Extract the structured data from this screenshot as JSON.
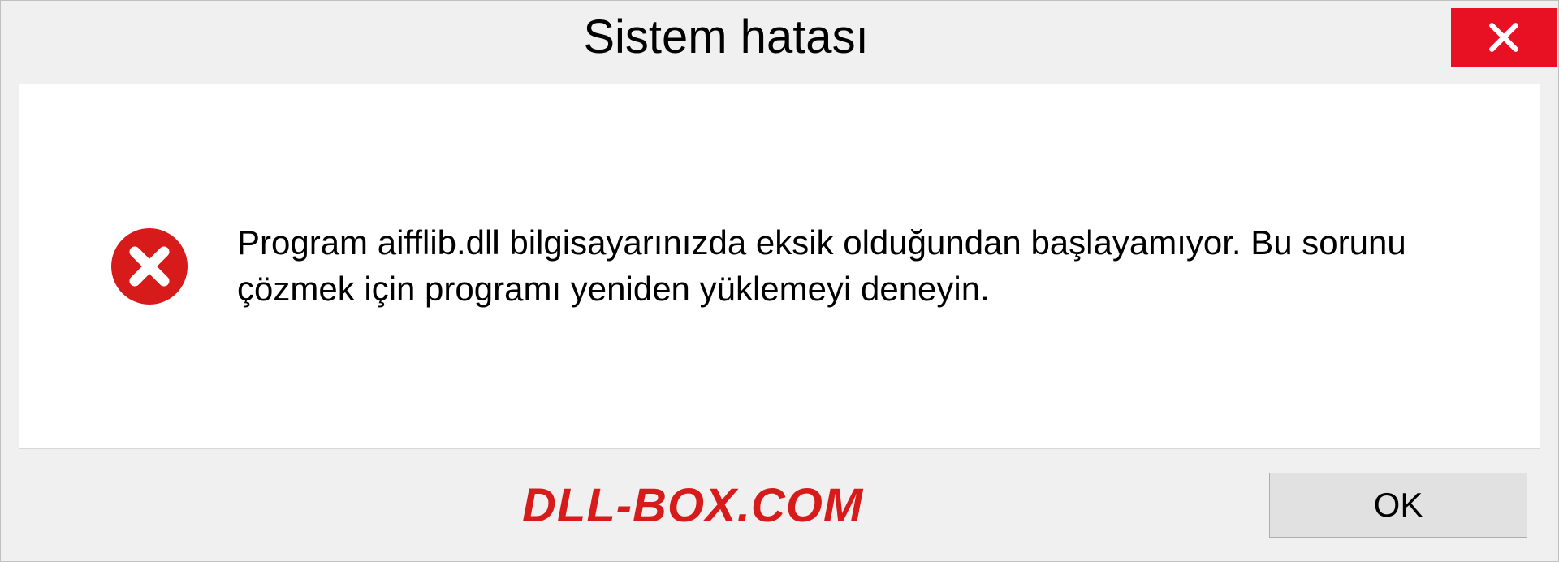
{
  "titlebar": {
    "title": "Sistem hatası"
  },
  "content": {
    "message": "Program aifflib.dll bilgisayarınızda eksik olduğundan başlayamıyor. Bu sorunu çözmek için programı yeniden yüklemeyi deneyin."
  },
  "footer": {
    "watermark": "DLL-BOX.COM",
    "ok_label": "OK"
  },
  "colors": {
    "close_button_bg": "#e81123",
    "error_icon_bg": "#d71a1a",
    "watermark_color": "#d71a1a"
  }
}
